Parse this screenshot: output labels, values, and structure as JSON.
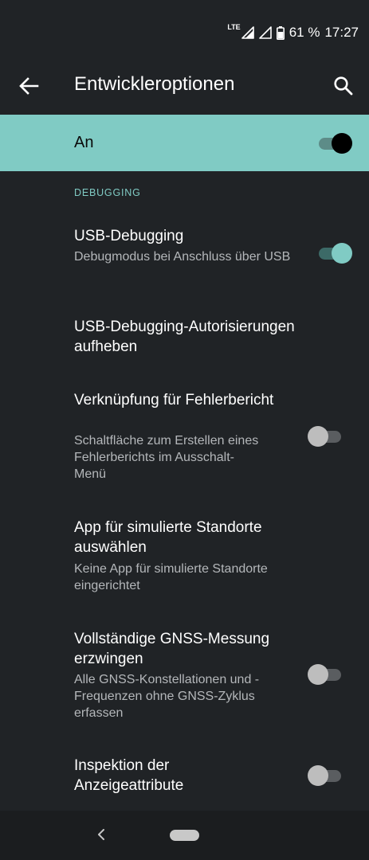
{
  "status_bar": {
    "network": "LTE",
    "battery": "61 %",
    "time": "17:27",
    "icons": [
      "signal-icon",
      "signal-icon",
      "battery-icon"
    ]
  },
  "app_bar": {
    "title": "Entwickleroptionen",
    "back_icon": "arrow-back-icon",
    "search_icon": "search-icon"
  },
  "master": {
    "label": "An",
    "enabled": true,
    "background_color": "#80cbc4"
  },
  "section": {
    "header": "DEBUGGING"
  },
  "preferences": [
    {
      "title": "USB-Debugging",
      "summary": "Debugmodus bei Anschluss über USB",
      "toggle": true
    },
    {
      "title": "USB-Debugging-Autorisierungen aufheben",
      "summary": ""
    },
    {
      "title": "Verknüpfung für Fehlerbericht",
      "summary": "Schaltfläche zum Erstellen eines Fehlerberichts im Ausschalt-Menü",
      "toggle": false
    },
    {
      "title": "App für simulierte Standorte auswählen",
      "summary": "Keine App für simulierte Standorte eingerichtet"
    },
    {
      "title": "Vollständige GNSS-Messung erzwingen",
      "summary": "Alle GNSS-Konstellationen und -Frequenzen ohne GNSS-Zyklus erfassen",
      "toggle": false
    },
    {
      "title": "Inspektion der Anzeigeattribute",
      "summary": "",
      "toggle": false
    }
  ],
  "colors": {
    "accent": "#80cbc4",
    "background": "#202326",
    "summary_text": "#b4b7ba"
  },
  "nav_bar": {
    "back_icon": "chevron-left-icon",
    "home_icon": "home-pill-icon"
  }
}
